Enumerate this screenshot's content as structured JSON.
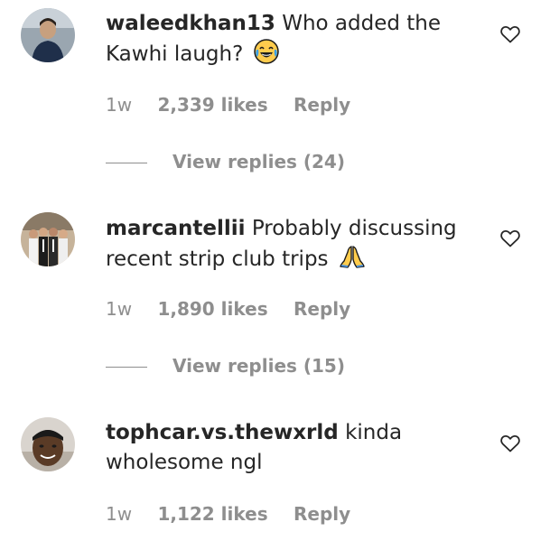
{
  "comments": [
    {
      "username": "waleedkhan13",
      "text": "Who added the Kawhi laugh?",
      "emoji": "laughing-emoji",
      "time": "1w",
      "likes": "2,339 likes",
      "reply": "Reply",
      "view_replies": "View replies (24)"
    },
    {
      "username": "marcantellii",
      "text": "Probably discussing recent strip club trips",
      "emoji": "praying-hands-emoji",
      "time": "1w",
      "likes": "1,890 likes",
      "reply": "Reply",
      "view_replies": "View replies (15)"
    },
    {
      "username": "tophcar.vs.thewxrld",
      "text": "kinda wholesome ngl",
      "time": "1w",
      "likes": "1,122 likes",
      "reply": "Reply"
    }
  ],
  "colors": {
    "text": "#262626",
    "muted": "#8e8e8e",
    "background": "#ffffff"
  },
  "icons": {
    "like": "heart-outline-icon"
  }
}
